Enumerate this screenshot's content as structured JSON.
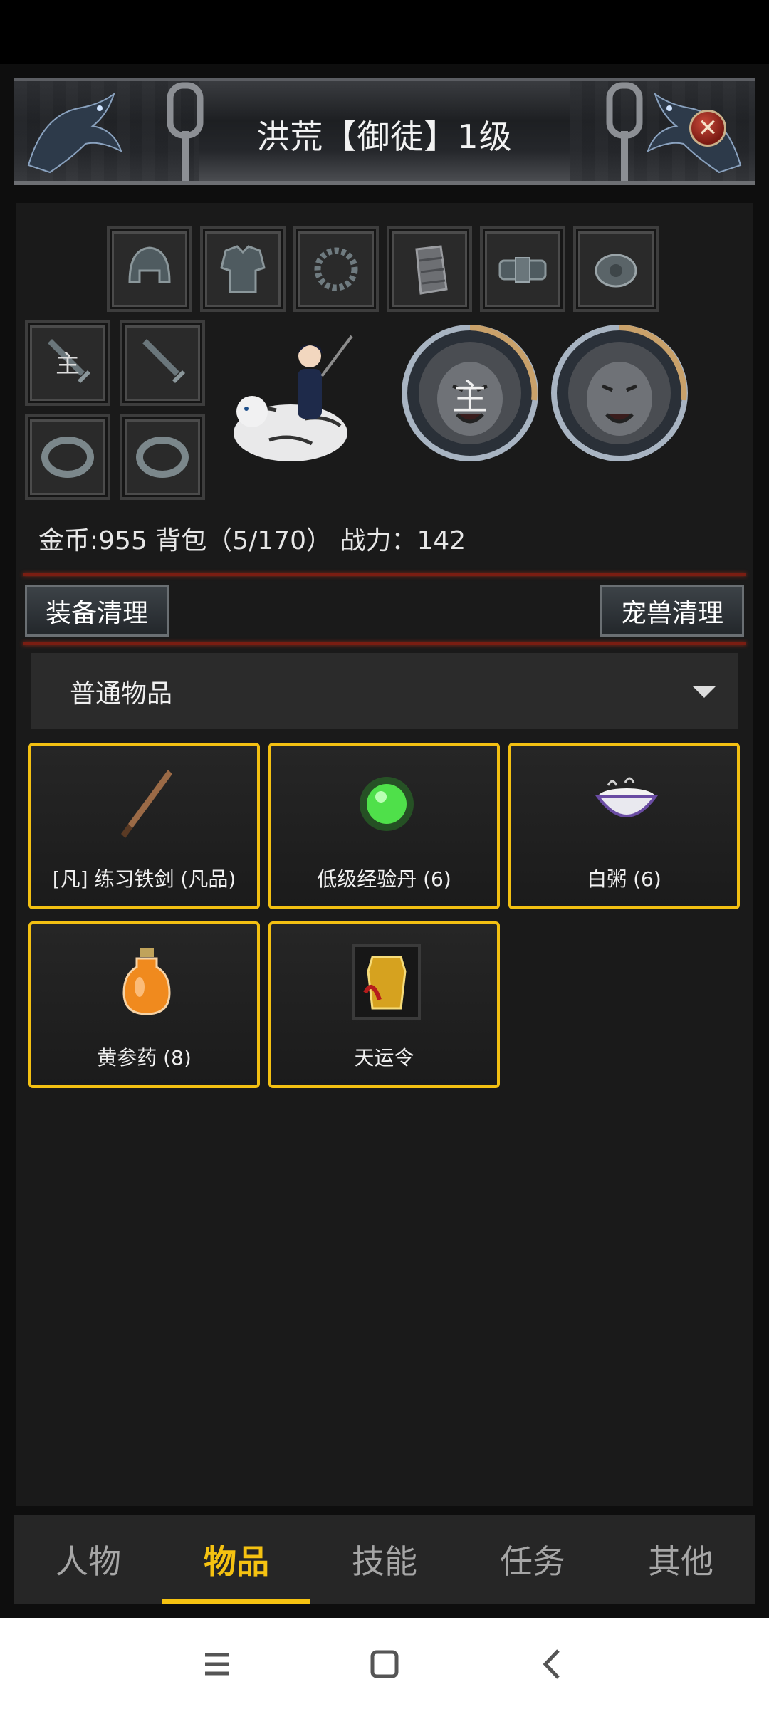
{
  "header": {
    "title": "洪荒【御徒】1级",
    "close_glyph": "✕"
  },
  "equipment": {
    "top_slots": [
      "helmet-icon",
      "armor-icon",
      "necklace-icon",
      "bracer-icon",
      "belt-icon",
      "boots-icon"
    ],
    "left_slots": [
      {
        "icon": "sword-icon",
        "label": "主"
      },
      {
        "icon": "sword-icon",
        "label": ""
      },
      {
        "icon": "ring-icon",
        "label": ""
      },
      {
        "icon": "ring-icon",
        "label": ""
      }
    ],
    "medallions": [
      {
        "label": "主"
      },
      {
        "label": ""
      }
    ]
  },
  "stats": {
    "text": "金币:955 背包（5/170） 战力：142"
  },
  "buttons": {
    "clean_equipment": "装备清理",
    "clean_pets": "宠兽清理"
  },
  "filter": {
    "selected": "普通物品"
  },
  "items": [
    {
      "label": "[凡] 练习铁剑 (凡品)",
      "icon": "bronze-sword-icon"
    },
    {
      "label": "低级经验丹 (6)",
      "icon": "green-pill-icon"
    },
    {
      "label": "白粥 (6)",
      "icon": "porridge-bowl-icon"
    },
    {
      "label": "黄参药 (8)",
      "icon": "potion-bottle-icon"
    },
    {
      "label": "天运令",
      "icon": "golden-token-icon"
    }
  ],
  "tabs": [
    {
      "label": "人物"
    },
    {
      "label": "物品",
      "active": true
    },
    {
      "label": "技能"
    },
    {
      "label": "任务"
    },
    {
      "label": "其他"
    }
  ],
  "colors": {
    "accent": "#f5c211",
    "item_border": "#f3c012",
    "divider": "#7a1d12"
  }
}
